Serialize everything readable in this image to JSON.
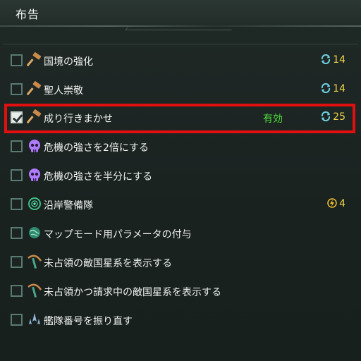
{
  "window": {
    "title": "布告"
  },
  "colors": {
    "highlight": "#e10f0f",
    "active": "#4fdc3a",
    "cost": "#f0d44a"
  },
  "edicts": [
    {
      "label": "国境の強化",
      "icon": "gavel-icon",
      "checked": false,
      "cost": "14",
      "cost_icon": "influence-icon"
    },
    {
      "label": "聖人崇敬",
      "icon": "gavel-icon",
      "checked": false,
      "cost": "14",
      "cost_icon": "influence-icon"
    },
    {
      "label": "成り行きまかせ",
      "icon": "gavel-icon",
      "checked": true,
      "status": "有効",
      "cost": "25",
      "cost_icon": "influence-icon"
    },
    {
      "label": "危機の強さを2倍にする",
      "icon": "skull-icon",
      "checked": false
    },
    {
      "label": "危機の強さを半分にする",
      "icon": "skull-icon",
      "checked": false
    },
    {
      "label": "沿岸警備隊",
      "icon": "radar-icon",
      "checked": false,
      "cost": "4",
      "cost_icon": "energy-icon"
    },
    {
      "label": "マップモード用パラメータの付与",
      "icon": "globe-icon",
      "checked": false
    },
    {
      "label": "未占領の敵国星系を表示する",
      "icon": "pickaxe-icon",
      "checked": false
    },
    {
      "label": "未占領かつ請求中の敵国星系を表示する",
      "icon": "pickaxe-icon",
      "checked": false
    },
    {
      "label": "艦隊番号を振り直す",
      "icon": "fleet-icon",
      "checked": false
    }
  ]
}
